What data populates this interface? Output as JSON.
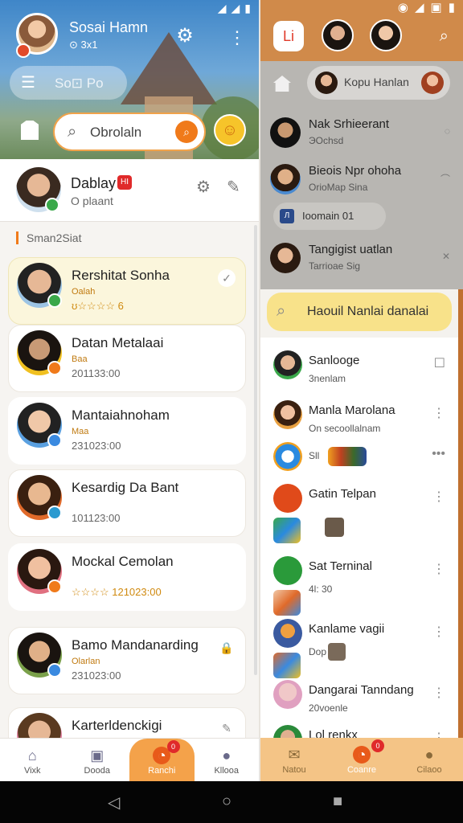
{
  "colors": {
    "accent": "#f07a1a",
    "online": "#3aa84a",
    "alert": "#e02a2a",
    "highlight": "#f8e28a"
  },
  "left": {
    "profile": {
      "name": "Sosai Hamn",
      "sub": "⊙ 3x1"
    },
    "menu_text": "So⊡ Po",
    "search_placeholder": "Obrolaln",
    "me": {
      "name": "Dablay",
      "flag": "HI",
      "status": "O plaant"
    },
    "section_label": "Sman2Siat",
    "chats": [
      {
        "name": "Rershitat Sonha",
        "sub": "Oalah",
        "meta": "ʊ☆☆☆☆ 6"
      },
      {
        "name": "Datan Metalaai",
        "sub": "Baa",
        "meta": "201133:00"
      },
      {
        "name": "Mantaiahnoham",
        "sub": "Maa",
        "meta": "231023:00"
      },
      {
        "name": "Kesardig Da Bant",
        "sub": "",
        "meta": "101123:00"
      },
      {
        "name": "Mockal Cemolan",
        "sub": "",
        "meta": "☆☆☆☆  121023:00"
      },
      {
        "name": "Bamo Mandanarding",
        "sub": "Olarlan",
        "meta": "231023:00"
      },
      {
        "name": "Karterldenckigi",
        "sub": "",
        "meta": ""
      }
    ],
    "nav": [
      {
        "label": "Vixk"
      },
      {
        "label": "Dooda"
      },
      {
        "label": "Ranchi",
        "badge": "0"
      },
      {
        "label": "Kllooa"
      }
    ]
  },
  "right": {
    "logo": "Li",
    "pill_text": "Kopu Hanlan",
    "dim_rows": [
      {
        "name": "Nak Srhieerant",
        "sub": "ЭOchsd"
      },
      {
        "name": "Bieois Npr ohoha",
        "sub": "OrioMap Sina"
      }
    ],
    "dim_pill_text": "Ioomain  01",
    "dim_row3": {
      "name": "Tangigist uatlan",
      "sub": "Tarrioae Sig"
    },
    "search_text": "Haouil Nanlai danalai",
    "rows": [
      {
        "name": "Sanlooge",
        "sub": "3nenlam"
      },
      {
        "name": "Manla Marolana",
        "sub": "On secoollalnam"
      },
      {
        "name": "",
        "sub": "Sll"
      },
      {
        "name": "Gatin Telpan",
        "sub": ""
      },
      {
        "name": "Sat Terninal",
        "sub": "4l: 30"
      },
      {
        "name": "Kanlame vagii",
        "sub": "Dop"
      },
      {
        "name": "Dangarai Tanndang",
        "sub": "20voenle"
      },
      {
        "name": "Lol renkx",
        "sub": ""
      }
    ],
    "nav": [
      {
        "label": "Natou"
      },
      {
        "label": "Coanre",
        "badge": "0"
      },
      {
        "label": "Cilaoo"
      }
    ]
  }
}
